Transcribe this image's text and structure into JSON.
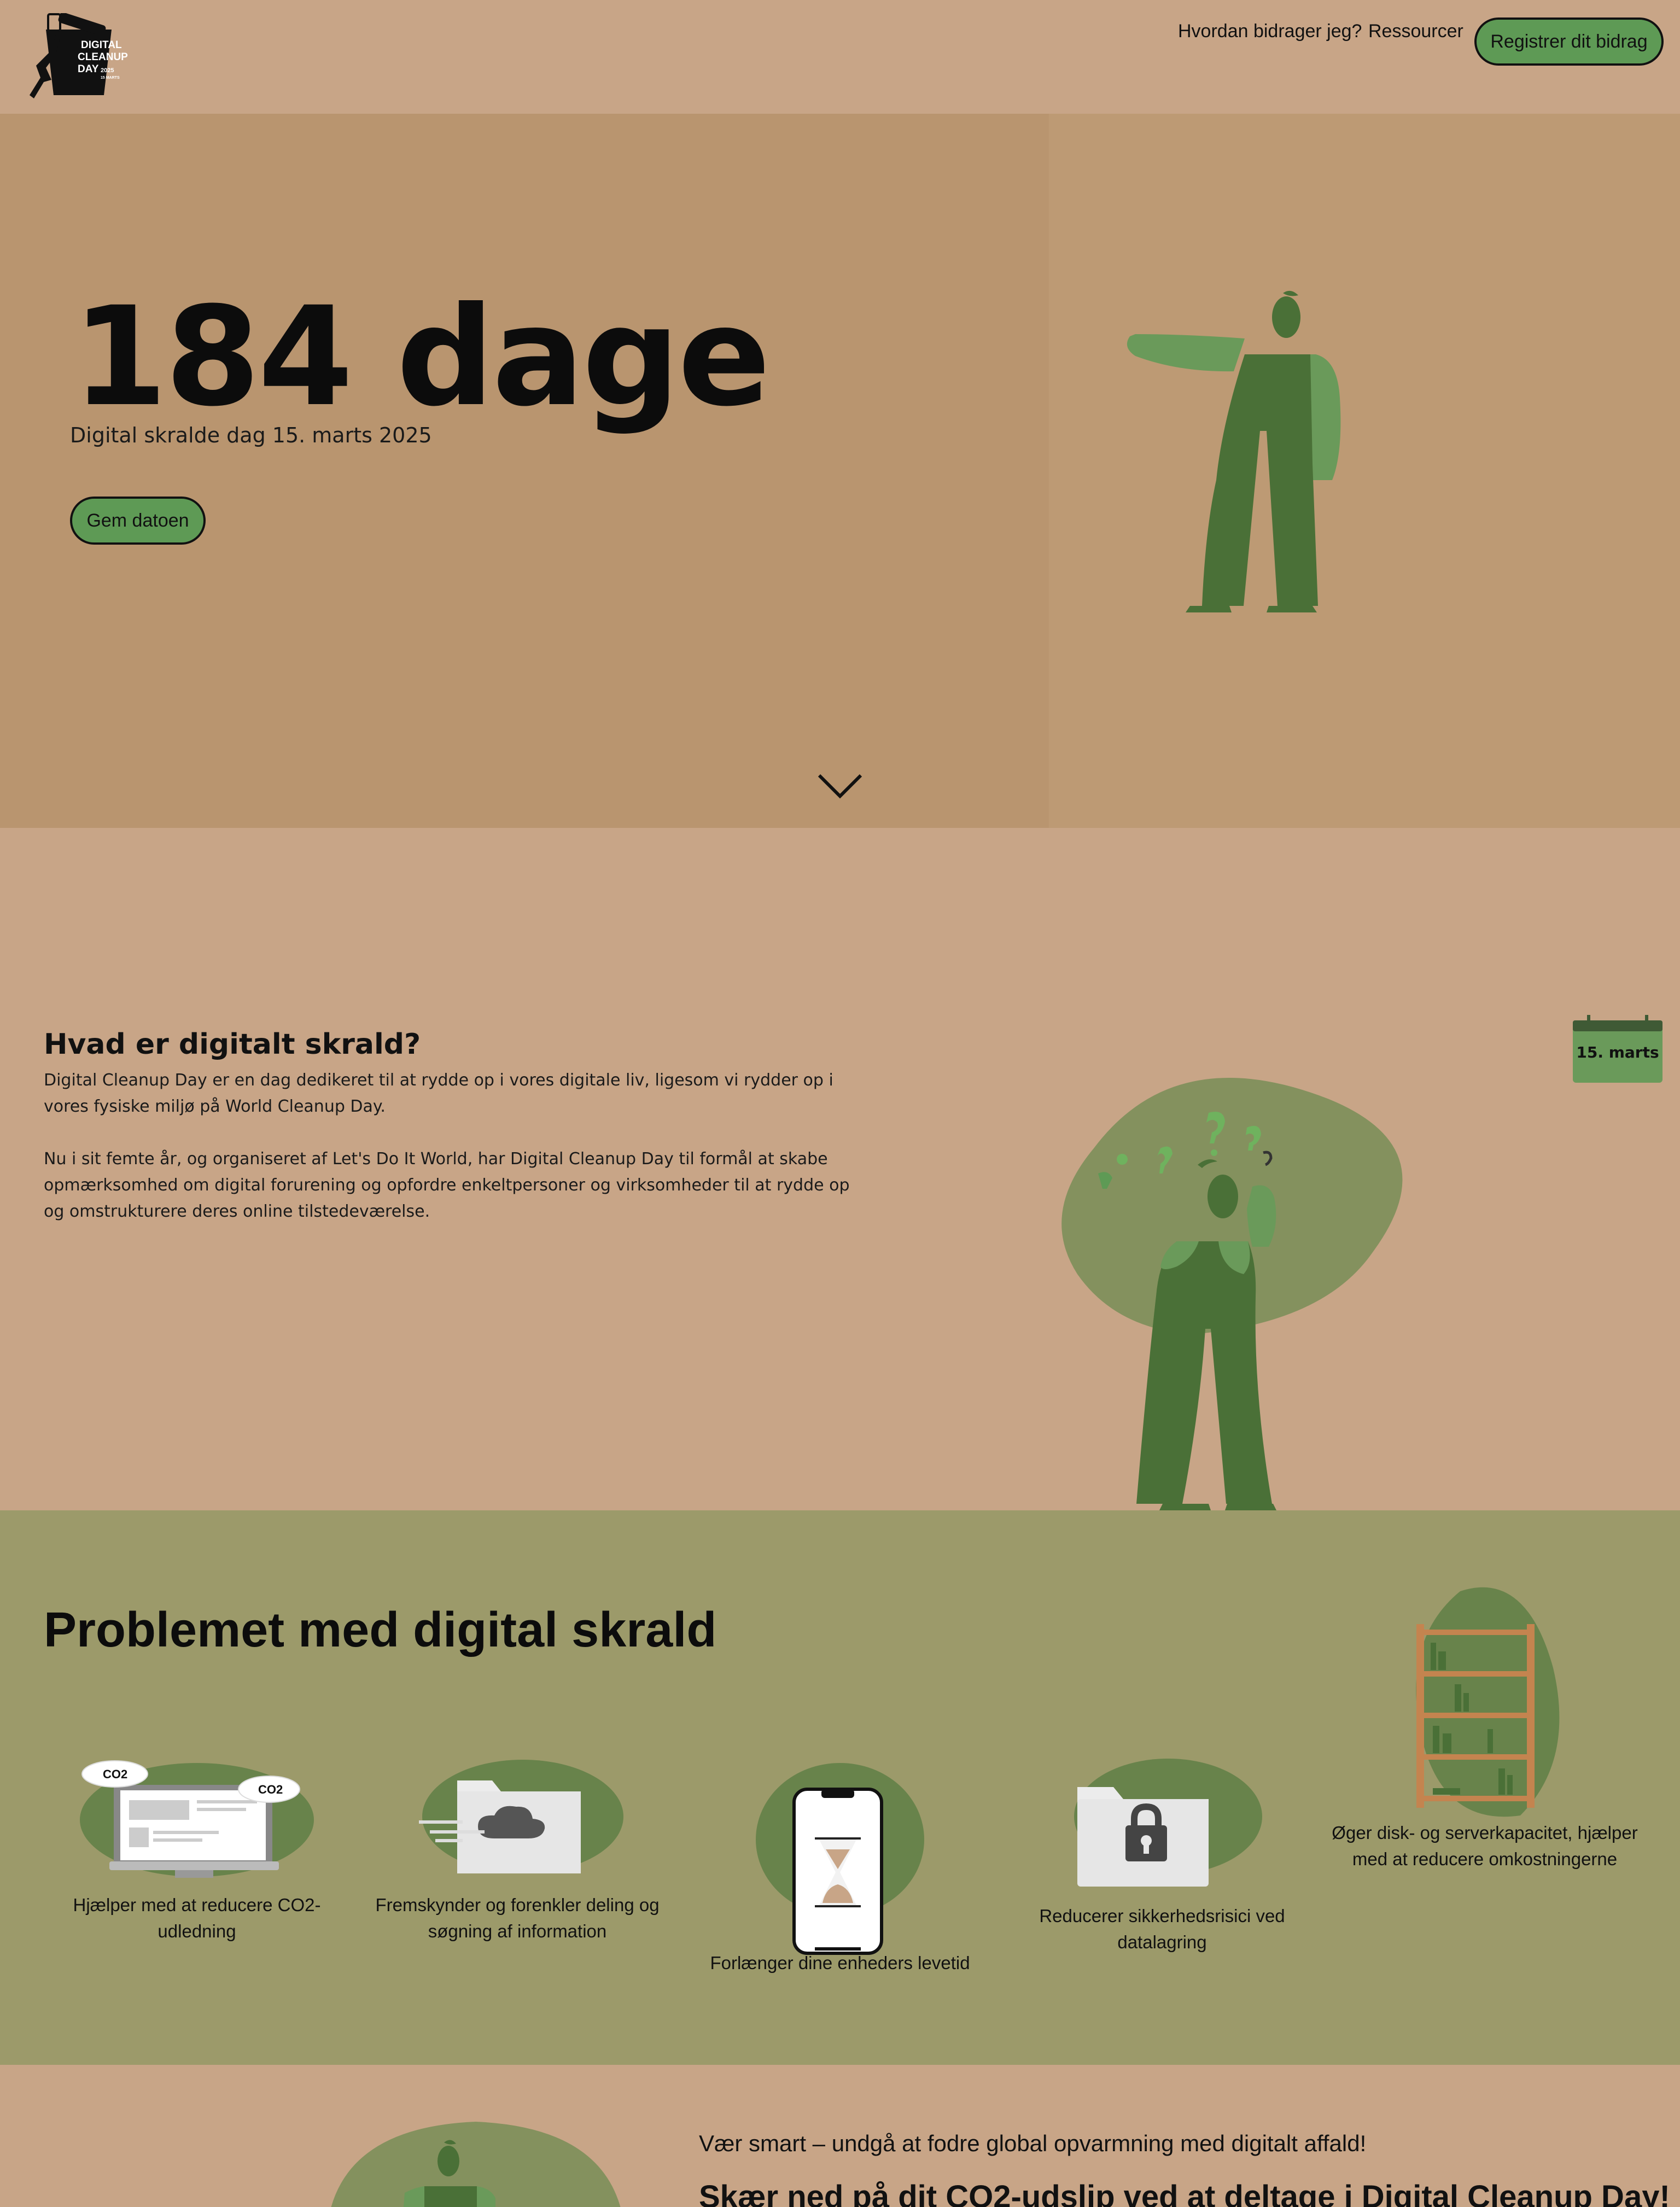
{
  "nav": {
    "logo_text": [
      "DIGITAL",
      "CLEANUP",
      "DAY",
      "2025",
      "15 MARTS"
    ],
    "links": [
      "Hvordan bidrager jeg?",
      "Ressourcer"
    ],
    "register_button": "Registrer dit bidrag"
  },
  "hero": {
    "countdown": "184 dage",
    "subtitle": "Digital skralde dag 15. marts 2025",
    "save_button": "Gem datoen"
  },
  "what": {
    "title": "Hvad er digitalt skrald?",
    "paragraph1": "Digital Cleanup Day er en dag dedikeret til at rydde op i vores digitale liv, ligesom vi rydder op i vores fysiske miljø på World Cleanup Day.",
    "paragraph2": "Nu i sit femte år, og organiseret af Let's Do It World, har Digital Cleanup Day til formål at skabe opmærksomhed om digital forurening og opfordre enkeltpersoner og virksomheder til at rydde op og omstrukturere deres online tilstedeværelse.",
    "calendar_label": "15. marts"
  },
  "problem": {
    "title": "Problemet med digital skrald",
    "cloud_label": "CO2",
    "benefits": [
      "Hjælper med at reducere CO2-udledning",
      "Fremskynder og forenkler deling og søgning af information",
      "Forlænger dine enheders levetid",
      "Reducerer sikkerhedsrisici ved datalagring",
      "Øger disk- og serverkapacitet, hjælper med at reducere omkostningerne"
    ]
  },
  "bottom": {
    "line1": "Vær smart – undgå at fodre global opvarmning med digitalt affald!",
    "line2": "Skær ned på dit CO2-udslip ved at deltage i Digital Cleanup Day!"
  },
  "colors": {
    "background": "#c8a587",
    "hero": "#b9956f",
    "problem_band": "#9c9a6a",
    "accent_green": "#5e9a55",
    "dark_green": "#4a7037",
    "blob_green": "#7c8f5a"
  }
}
